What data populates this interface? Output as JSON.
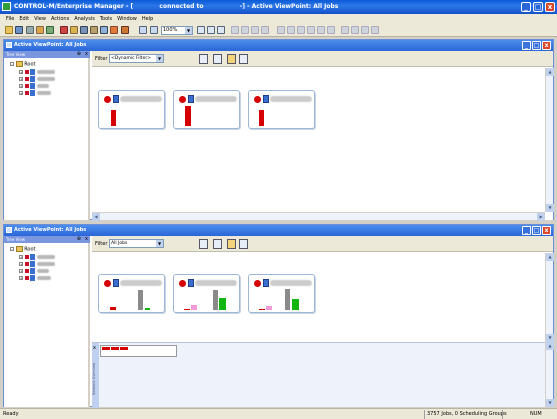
{
  "window": {
    "app_name": "CONTROL-M/Enterprise Manager - [",
    "connected": "connected to",
    "title_suffix": "-] - Active ViewPoint: All Jobs",
    "buttons": [
      "_",
      "□",
      "x"
    ]
  },
  "menu": [
    "File",
    "Edit",
    "View",
    "Actions",
    "Analysis",
    "Tools",
    "Window",
    "Help"
  ],
  "toolbar": {
    "zoom": "100%"
  },
  "viewpoints": [
    {
      "title": "Active ViewPoint: All Jobs",
      "tree_header": "Tree View",
      "tree_root": "Root",
      "filter_label": "Filter",
      "filter_value": "<Dynamic Filter>"
    },
    {
      "title": "Active ViewPoint: All Jobs",
      "tree_header": "Tree View",
      "tree_root": "Root",
      "filter_label": "Filter",
      "filter_value": "All Jobs",
      "side_tab": "Network Overview"
    }
  ],
  "status": {
    "left": "Ready",
    "jobs": "3757 Jobs, 0 Scheduling Groups",
    "num": "NUM"
  },
  "colors": {
    "title_blue": "#2a66d8",
    "alert_red": "#d60000",
    "bar_gray": "#8a8a8a",
    "bar_pink": "#f29ad8",
    "bar_green": "#11b611"
  }
}
